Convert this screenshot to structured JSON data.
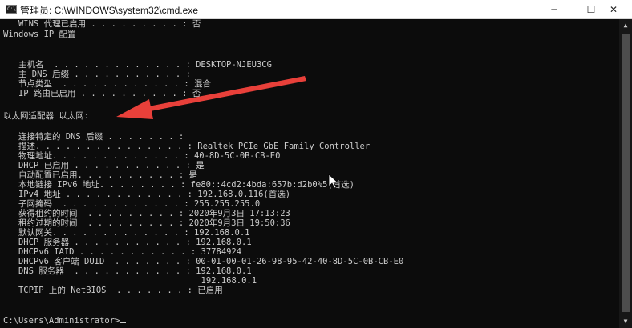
{
  "window": {
    "title": "管理员: C:\\WINDOWS\\system32\\cmd.exe",
    "icon_label": "C:\\",
    "controls": {
      "minimize": "─",
      "maximize": "☐",
      "close": "✕"
    }
  },
  "console": {
    "lines": [
      "Windows IP 配置",
      "",
      "   主机名  . . . . . . . . . . . . . : DESKTOP-NJEU3CG",
      "   主 DNS 后缀 . . . . . . . . . . . :",
      "   节点类型  . . . . . . . . . . . . : 混合",
      "   IP 路由已启用 . . . . . . . . . . : 否",
      "   WINS 代理已启用 . . . . . . . . . : 否",
      "",
      "以太网适配器 以太网:",
      "",
      "   连接特定的 DNS 后缀 . . . . . . . :",
      "   描述. . . . . . . . . . . . . . . : Realtek PCIe GbE Family Controller",
      "   物理地址. . . . . . . . . . . . . : 40-8D-5C-0B-CB-E0",
      "   DHCP 已启用 . . . . . . . . . . . : 是",
      "   自动配置已启用. . . . . . . . . . : 是",
      "   本地链接 IPv6 地址. . . . . . . . : fe80::4cd2:4bda:657b:d2b0%5(首选)",
      "   IPv4 地址 . . . . . . . . . . . . : 192.168.0.116(首选)",
      "   子网掩码  . . . . . . . . . . . . : 255.255.255.0",
      "   获得租约的时间  . . . . . . . . . : 2020年9月3日 17:13:23",
      "   租约过期的时间  . . . . . . . . . : 2020年9月3日 19:50:36",
      "   默认网关. . . . . . . . . . . . . : 192.168.0.1",
      "   DHCP 服务器 . . . . . . . . . . . : 192.168.0.1",
      "   DHCPv6 IAID . . . . . . . . . . . : 37784924",
      "   DHCPv6 客户端 DUID  . . . . . . . : 00-01-00-01-26-98-95-42-40-8D-5C-0B-CB-E0",
      "   DNS 服务器  . . . . . . . . . . . : 192.168.0.1",
      "                                       192.168.0.1",
      "   TCPIP 上的 NetBIOS  . . . . . . . : 已启用",
      "",
      "C:\\Users\\Administrator>"
    ]
  },
  "annotation": {
    "arrow_color": "#e8403a"
  },
  "colors": {
    "console_bg": "#0c0c0c",
    "console_fg": "#cccccc",
    "titlebar_bg": "#ffffff"
  }
}
